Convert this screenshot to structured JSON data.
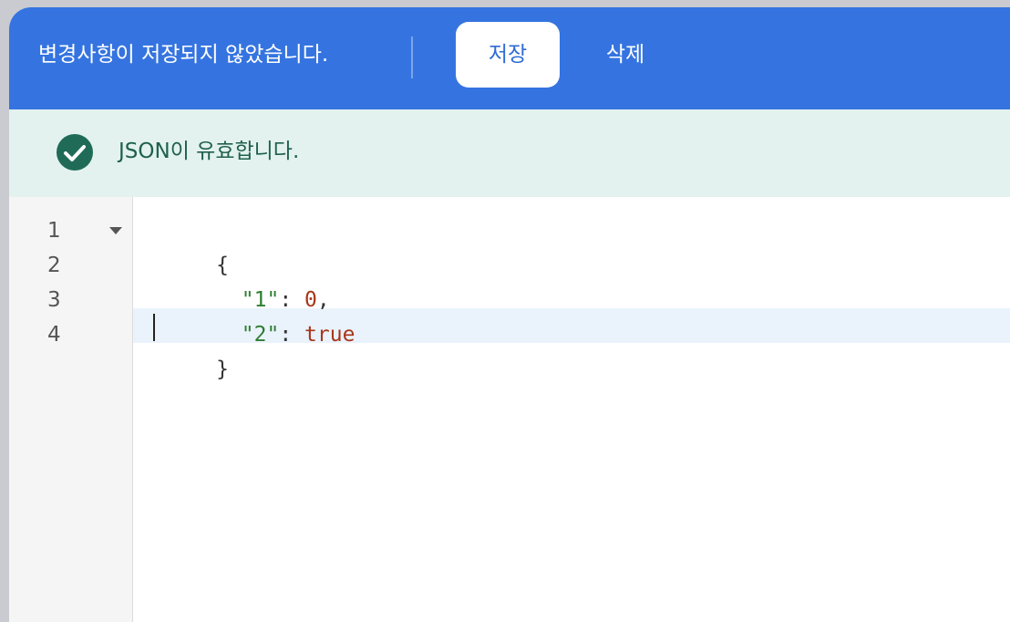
{
  "topbar": {
    "unsaved_message": "변경사항이 저장되지 않았습니다.",
    "save_label": "저장",
    "delete_label": "삭제",
    "color": "#3574e0"
  },
  "status": {
    "message": "JSON이 유효합니다.",
    "icon": "check-circle-icon",
    "color": "#1f5f4e",
    "background": "#e3f2ef"
  },
  "editor": {
    "line_numbers": [
      "1",
      "2",
      "3",
      "4"
    ],
    "lines": [
      {
        "open": "{"
      },
      {
        "key": "\"1\"",
        "sep": ": ",
        "value": "0",
        "trail": ","
      },
      {
        "key": "\"2\"",
        "sep": ": ",
        "value": "true",
        "trail": ""
      },
      {
        "close": "}"
      }
    ],
    "active_line": 4
  }
}
